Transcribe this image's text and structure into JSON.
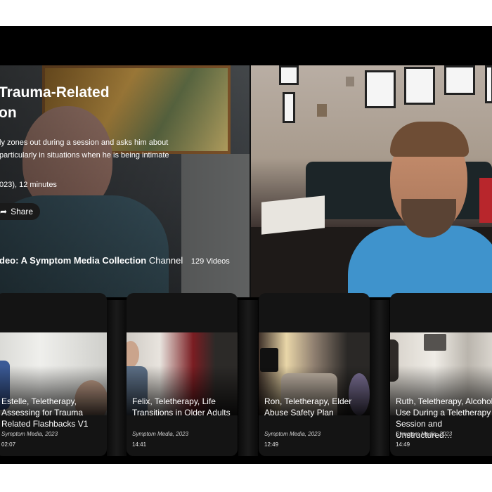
{
  "hero": {
    "title": "Trauma-Related\non",
    "description": "ly zones out during a session and asks him about\nparticularly in situations when he is being intimate",
    "meta": "023), 12 minutes",
    "share_label": "Share",
    "channel_name": "deo: A Symptom Media Collection",
    "channel_suffix": "Channel",
    "video_count": "129 Videos"
  },
  "cards": [
    {
      "title": "Estelle, Teletherapy, Assessing for Trauma Related Flashbacks V1",
      "source": "Symptom Media, 2023",
      "duration": "02:07"
    },
    {
      "title": "Felix, Teletherapy, Life Transitions in Older Adults",
      "source": "Symptom Media, 2023",
      "duration": "14:41"
    },
    {
      "title": "Ron, Teletherapy, Elder Abuse Safety Plan",
      "source": "Symptom Media, 2023",
      "duration": "12:49"
    },
    {
      "title": "Ruth, Teletherapy, Alcohol Use During a Teletherapy Session and Unstructured…",
      "source": "Symptom Media, 2023",
      "duration": "14:49"
    }
  ],
  "icons": {
    "share": "share-icon"
  },
  "colors": {
    "background": "#000000",
    "text": "#ffffff",
    "accent_shirt": "#3f93cc"
  }
}
